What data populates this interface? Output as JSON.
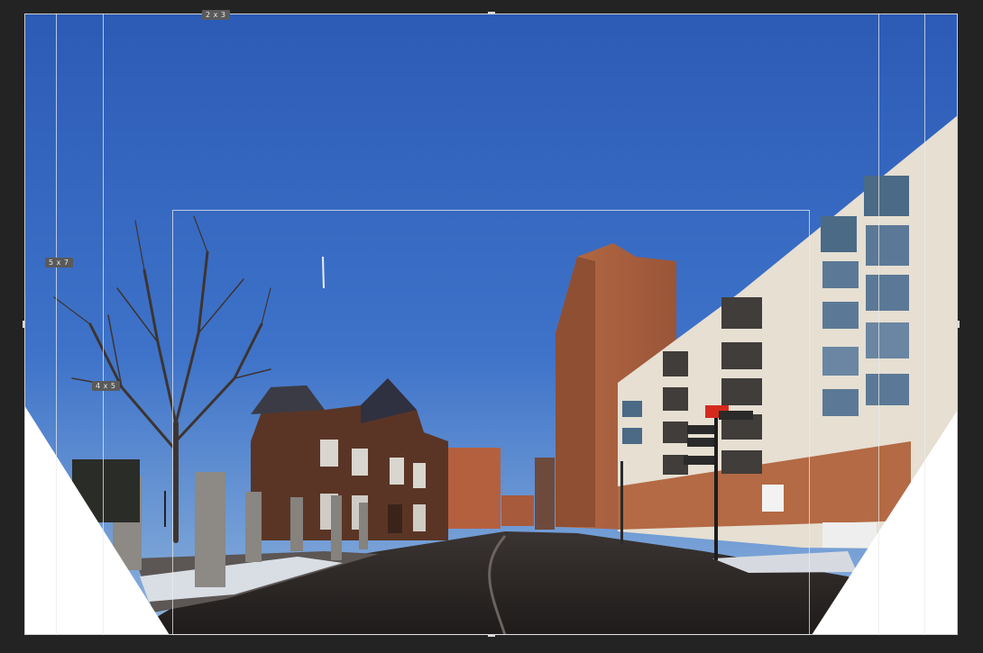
{
  "crop_overlay": {
    "ratio_labels": [
      "2 x 3",
      "5 x 7",
      "4 x 5"
    ]
  },
  "colors": {
    "workspace_bg": "#232323",
    "sky_top": "#2f5fb8",
    "sky_bottom": "#7ea8d8",
    "transparent_fill": "#ffffff",
    "guide_line": "#e8e8e8",
    "label_bg": "#5a5a5a"
  },
  "icons": [
    "crop-handle"
  ]
}
